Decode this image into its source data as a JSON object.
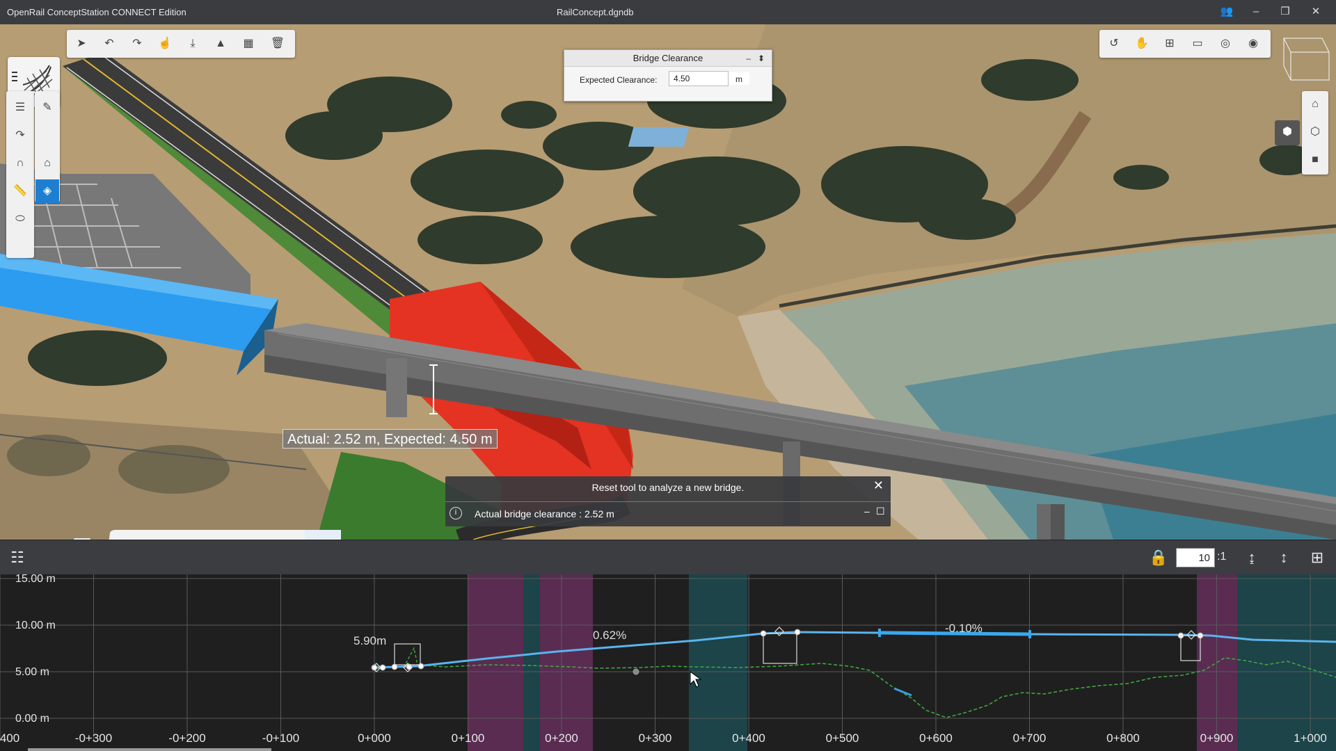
{
  "window": {
    "app_title": "OpenRail ConceptStation CONNECT Edition",
    "document_title": "RailConcept.dgndb",
    "controls": {
      "users": "👥",
      "minimize": "–",
      "restore": "❐",
      "close": "✕"
    }
  },
  "bridge_clearance": {
    "title": "Bridge Clearance",
    "minimize": "–",
    "pin": "⬍",
    "label": "Expected Clearance:",
    "value": "4.50",
    "unit": "m"
  },
  "clearance_label": "Actual: 2.52 m, Expected: 4.50 m",
  "message": {
    "line1": "Reset tool to analyze a new bridge.",
    "line2": "Actual bridge clearance : 2.52 m",
    "info_icon": "i",
    "close": "✕",
    "minimize": "–",
    "maximize": "☐"
  },
  "profile": {
    "scale_value": "10",
    "scale_suffix": ":1",
    "y_labels": [
      "15.00 m",
      "10.00 m",
      "5.00 m",
      "0.00 m"
    ],
    "x_labels": [
      "400",
      "-0+300",
      "-0+200",
      "-0+100",
      "0+000",
      "0+100",
      "0+200",
      "0+300",
      "0+400",
      "0+500",
      "0+600",
      "0+700",
      "0+800",
      "0+900",
      "1+000"
    ],
    "annotations": {
      "elev": "5.90m",
      "grade1": "0.62%",
      "grade2": "-0.10%"
    }
  },
  "colors": {
    "accent": "#1e7fd0",
    "bridge_red": "#e43322",
    "corridor_blue": "#2b9cf0",
    "profile_line": "#5ab4ee",
    "ground_line": "#3ea83e",
    "purple_band": "#5a2c52",
    "teal_band": "#1c4449"
  },
  "icons": {
    "top_toolbar": [
      "select-icon",
      "undo-icon",
      "redo-icon",
      "pointer-icon",
      "export-icon",
      "terrain-icon",
      "grid-icon",
      "delete-icon"
    ],
    "view_toolbar": [
      "rotate-icon",
      "pan-icon",
      "fit-icon",
      "window-icon",
      "zoom-icon",
      "camera-icon"
    ],
    "left_tools": [
      "road-icon",
      "pencil-icon",
      "curve-icon",
      "bridge-icon",
      "bridge-tool-icon",
      "measure-icon",
      "clearance-icon",
      "tunnel-icon"
    ],
    "viewport_tabs": [
      "collapse-icon",
      "landscape-icon",
      "layers-icon",
      "palette-icon",
      "analysis-icon",
      "bridge-tab-icon",
      "profile-tab-icon"
    ]
  }
}
